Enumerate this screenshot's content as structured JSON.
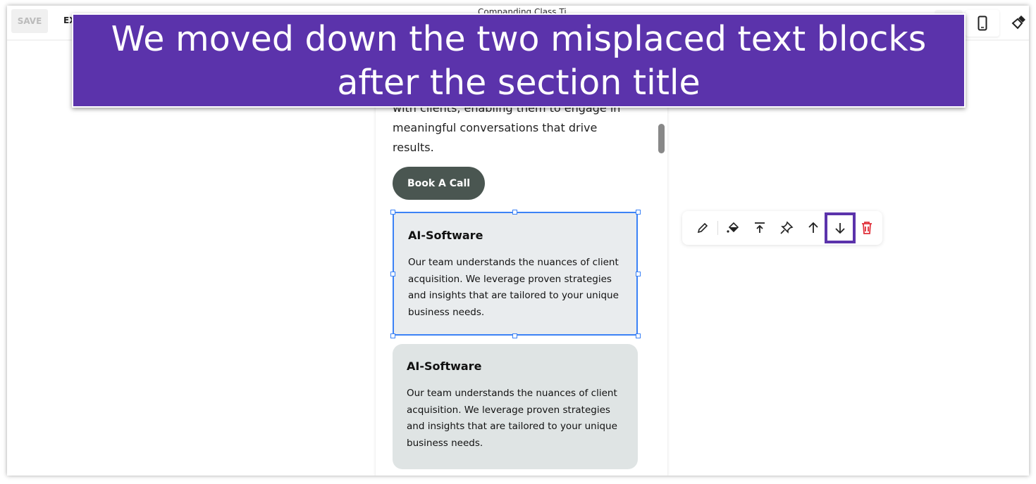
{
  "toolbar": {
    "save_label": "SAVE",
    "ex_label": "EX",
    "title": "Companding Class Ti"
  },
  "preview": {
    "text_line1": "with clients, enabling them to engage in",
    "text_line2": "meaningful conversations that drive",
    "text_line3": "results.",
    "cta_label": "Book A Call",
    "cards": [
      {
        "title": "AI-Software",
        "body": "Our team understands the nuances of client acquisition. We leverage proven strategies and insights that are tailored to your unique business needs."
      },
      {
        "title": "AI-Software",
        "body": "Our team understands the nuances of client acquisition. We leverage proven strategies and insights that are tailored to your unique business needs."
      }
    ]
  },
  "element_toolbar": {
    "icons": [
      "pencil-icon",
      "paint-bucket-icon",
      "move-to-top-icon",
      "pin-icon",
      "arrow-up-icon",
      "arrow-down-icon",
      "trash-icon"
    ],
    "highlighted": "arrow-down-icon",
    "highlight_color": "#5b33ab",
    "delete_color": "#e0303a"
  },
  "banner": {
    "line1": "We moved down the two misplaced text blocks",
    "line2": "after the section title",
    "color": "#5b33ab"
  }
}
